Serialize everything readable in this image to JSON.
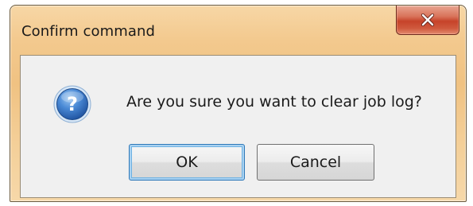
{
  "dialog": {
    "title": "Confirm command",
    "message": "Are you sure you want to clear job log?",
    "icon": "question-icon",
    "close_icon": "close-icon",
    "buttons": {
      "ok_label": "OK",
      "cancel_label": "Cancel"
    },
    "colors": {
      "titlebar": "#f3c98e",
      "close_button": "#c6432a",
      "content_bg": "#f0f0f0",
      "question_icon": "#2e68b5",
      "default_button_focus": "#2f78b8"
    }
  }
}
